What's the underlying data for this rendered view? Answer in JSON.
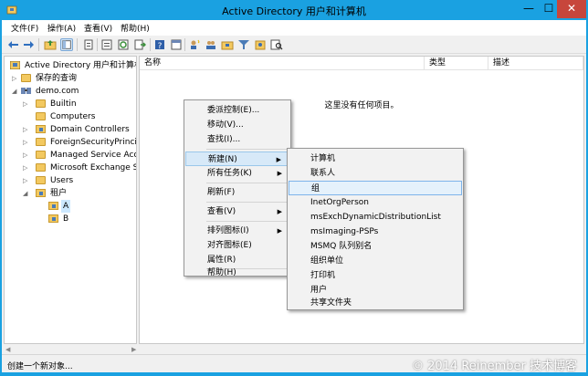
{
  "window": {
    "title": "Active Directory 用户和计算机",
    "min_glyph": "—",
    "max_glyph": "☐",
    "close_glyph": "✕"
  },
  "menubar": [
    {
      "label": "文件(F)"
    },
    {
      "label": "操作(A)"
    },
    {
      "label": "查看(V)"
    },
    {
      "label": "帮助(H)"
    }
  ],
  "toolbar_icons": [
    "back-icon",
    "forward-icon",
    "up-folder-icon",
    "show-tree-icon",
    "copy-icon",
    "properties-icon",
    "refresh-icon",
    "export-icon",
    "help-icon",
    "console-icon",
    "new-user-icon",
    "new-group-icon",
    "new-ou-icon",
    "filter-icon",
    "add-to-group-icon",
    "find-icon"
  ],
  "tree": {
    "root": "Active Directory 用户和计算机",
    "saved_queries": "保存的查询",
    "domain": "demo.com",
    "children": [
      {
        "label": "Builtin",
        "has_expander": true,
        "type": "folder"
      },
      {
        "label": "Computers",
        "has_expander": false,
        "type": "folder"
      },
      {
        "label": "Domain Controllers",
        "has_expander": true,
        "type": "ou"
      },
      {
        "label": "ForeignSecurityPrincipa",
        "has_expander": true,
        "type": "folder"
      },
      {
        "label": "Managed Service Acco",
        "has_expander": true,
        "type": "folder"
      },
      {
        "label": "Microsoft Exchange Se",
        "has_expander": true,
        "type": "folder"
      },
      {
        "label": "Users",
        "has_expander": true,
        "type": "folder"
      },
      {
        "label": "租户",
        "has_expander": true,
        "type": "ou"
      }
    ],
    "tenant_children": [
      {
        "label": "A",
        "type": "ou",
        "selected": true
      },
      {
        "label": "B",
        "type": "ou",
        "selected": false
      }
    ]
  },
  "list": {
    "columns": [
      "名称",
      "类型",
      "描述"
    ],
    "empty_message": "这里没有任何项目。"
  },
  "context_menu": {
    "items": [
      {
        "label": "委派控制(E)...",
        "sub": false
      },
      {
        "label": "移动(V)...",
        "sub": false
      },
      {
        "label": "查找(I)...",
        "sub": false
      },
      {
        "sep": true
      },
      {
        "label": "新建(N)",
        "sub": true,
        "highlight": true
      },
      {
        "label": "所有任务(K)",
        "sub": true
      },
      {
        "sep": true
      },
      {
        "label": "刷新(F)",
        "sub": false
      },
      {
        "sep": true
      },
      {
        "label": "查看(V)",
        "sub": true
      },
      {
        "sep": true
      },
      {
        "label": "排列图标(I)",
        "sub": true
      },
      {
        "label": "对齐图标(E)",
        "sub": false
      },
      {
        "label": "属性(R)",
        "sub": false
      },
      {
        "sep": true
      },
      {
        "label": "帮助(H)",
        "sub": false
      }
    ]
  },
  "submenu": {
    "items": [
      {
        "label": "计算机"
      },
      {
        "label": "联系人"
      },
      {
        "label": "组",
        "highlight": true
      },
      {
        "label": "InetOrgPerson"
      },
      {
        "label": "msExchDynamicDistributionList"
      },
      {
        "label": "msImaging-PSPs"
      },
      {
        "label": "MSMQ 队列别名"
      },
      {
        "label": "组织单位"
      },
      {
        "label": "打印机"
      },
      {
        "label": "用户"
      },
      {
        "label": "共享文件夹"
      }
    ]
  },
  "status": {
    "text": "创建一个新对象...",
    "watermark": "© 2014 Reinember 技术博客"
  },
  "colors": {
    "titlebar": "#1aa1e1",
    "close": "#c7463c",
    "menu_highlight": "#d7e9f8",
    "submenu_highlight": "#e5f1fb"
  }
}
